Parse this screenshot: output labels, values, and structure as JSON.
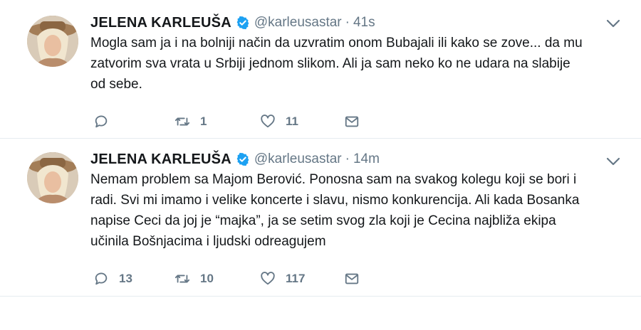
{
  "tweets": [
    {
      "author_name": "JELENA KARLEUŠA",
      "handle": "@karleusastar",
      "separator": "·",
      "time": "41s",
      "text_lines": [
        "Mogla sam ja i na bolniji način da uzvratim onom Bubajali ili kako se zove... da mu",
        "zatvorim sva vrata u Srbiji jednom slikom. Ali ja sam neko ko ne udara na slabije",
        "od sebe."
      ],
      "replies": "",
      "retweets": "1",
      "likes": "11"
    },
    {
      "author_name": "JELENA KARLEUŠA",
      "handle": "@karleusastar",
      "separator": "·",
      "time": "14m",
      "text_lines": [
        "Nemam problem sa Majom Berović. Ponosna sam na svakog kolegu koji se bori i",
        "radi. Svi mi imamo i velike koncerte i slavu, nismo konkurencija. Ali kada Bosanka",
        "napise Ceci da joj je “majka”, ja se setim svog zla koji je Cecina najbliža ekipa",
        "učinila Bošnjacima i ljudski odreagujem"
      ],
      "replies": "13",
      "retweets": "10",
      "likes": "117"
    }
  ],
  "icons": {
    "reply": "reply-icon",
    "retweet": "retweet-icon",
    "like": "heart-icon",
    "message": "envelope-icon",
    "verified": "verified-badge-icon",
    "menu": "chevron-down-icon"
  },
  "colors": {
    "verified": "#1da1f2",
    "muted": "#657786",
    "text": "#14171a",
    "divider": "#e6ecf0"
  }
}
